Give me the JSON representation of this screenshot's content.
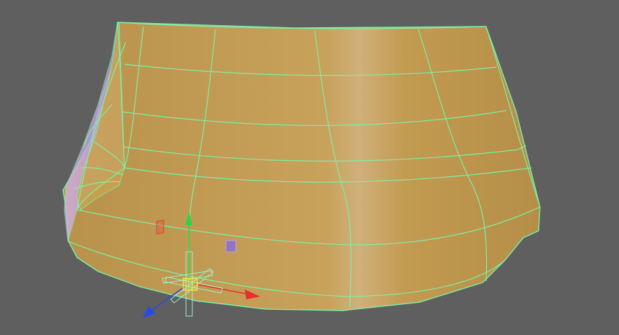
{
  "viewport": {
    "background": "#5f5f5f",
    "mesh": {
      "fill": "#c29a4f",
      "fill_shadow": "#b38c44",
      "highlight": "#cfae70",
      "wire": "#7df0a8",
      "edge_lilac": "#c9a7e6"
    },
    "gizmo": {
      "x_axis_color": "#e82e2e",
      "y_axis_color": "#2fd14a",
      "z_axis_color": "#2a4ae8",
      "center_handle_color": "#f2e63a",
      "handle_outline": "#9ff0d0"
    },
    "markers": [
      {
        "name": "red-vertex-marker",
        "color": "#e04a3a"
      },
      {
        "name": "purple-vertex-marker",
        "color": "#8a6ad8"
      }
    ]
  }
}
